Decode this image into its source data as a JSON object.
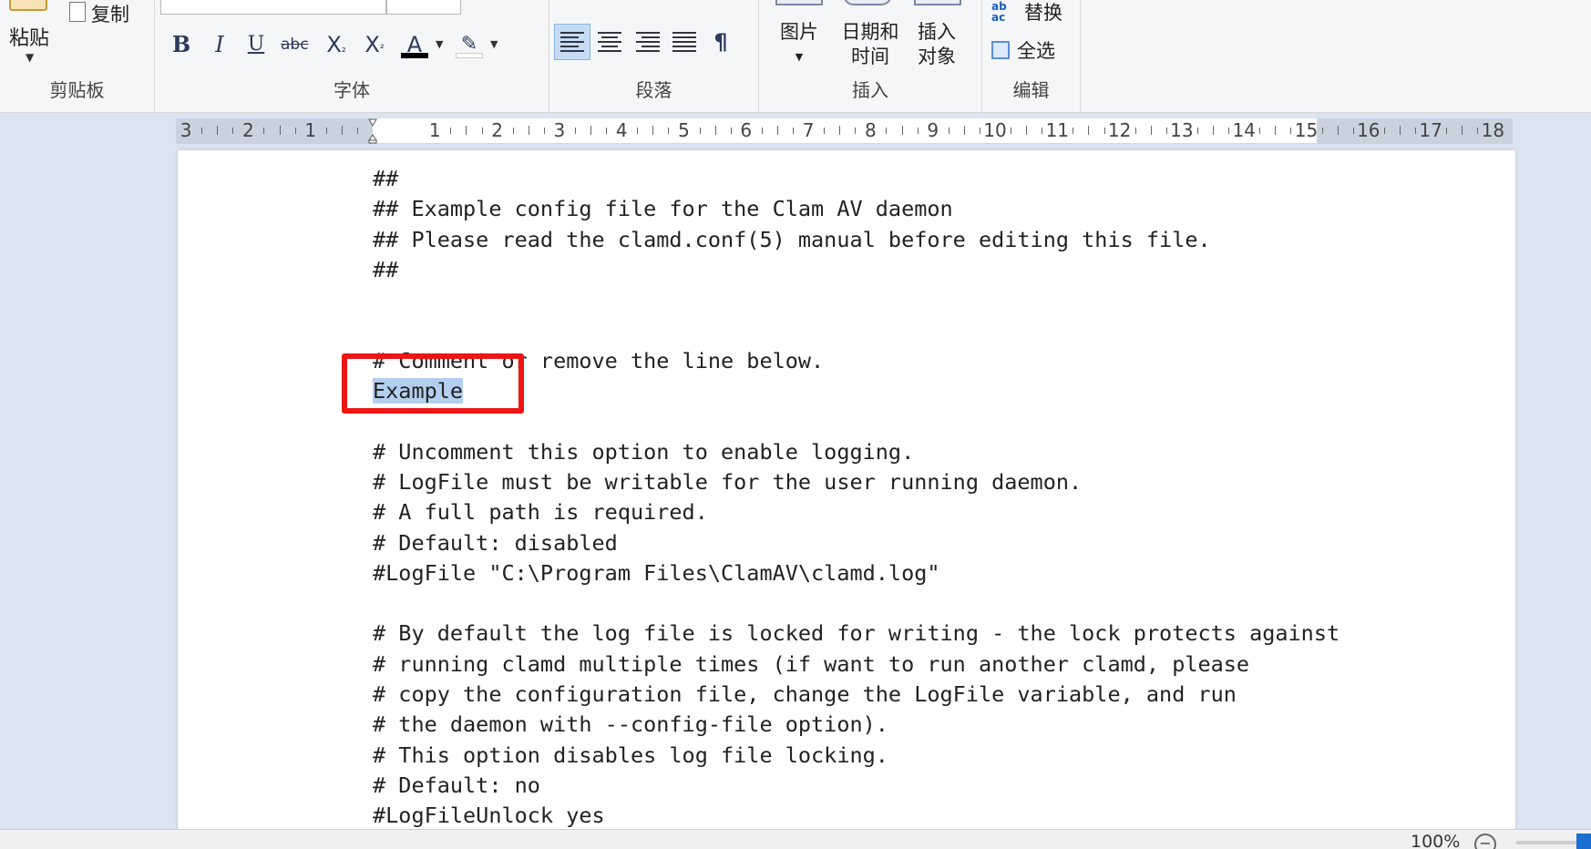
{
  "ribbon": {
    "clipboard": {
      "paste_label": "粘贴",
      "copy_label": "复制",
      "group_label": "剪贴板"
    },
    "font": {
      "group_label": "字体",
      "bold": "B",
      "italic": "I",
      "underline": "U",
      "strike": "abc",
      "subscript": "X",
      "superscript": "X",
      "font_color": "A",
      "highlight": "✎"
    },
    "paragraph": {
      "group_label": "段落",
      "show_marks": "¶"
    },
    "insert": {
      "group_label": "插入",
      "picture_label": "图片",
      "datetime_label_1": "日期和",
      "datetime_label_2": "时间",
      "object_label_1": "插入",
      "object_label_2": "对象"
    },
    "edit": {
      "group_label": "编辑",
      "replace_label": "替换",
      "select_all_label": "全选"
    }
  },
  "ruler": {
    "numbers": [
      "3",
      "2",
      "1",
      "1",
      "2",
      "3",
      "4",
      "5",
      "6",
      "7",
      "8",
      "9",
      "10",
      "11",
      "12",
      "13",
      "14",
      "15",
      "16",
      "17",
      "18"
    ]
  },
  "document": {
    "lines": [
      "##",
      "## Example config file for the Clam AV daemon",
      "## Please read the clamd.conf(5) manual before editing this file.",
      "##",
      "",
      "",
      "# Comment or remove the line below.",
      "Example",
      "",
      "# Uncomment this option to enable logging.",
      "# LogFile must be writable for the user running daemon.",
      "# A full path is required.",
      "# Default: disabled",
      "#LogFile \"C:\\Program Files\\ClamAV\\clamd.log\"",
      "",
      "# By default the log file is locked for writing - the lock protects against",
      "# running clamd multiple times (if want to run another clamd, please",
      "# copy the configuration file, change the LogFile variable, and run",
      "# the daemon with --config-file option).",
      "# This option disables log file locking.",
      "# Default: no",
      "#LogFileUnlock yes"
    ],
    "selected_line_index": 7
  },
  "statusbar": {
    "zoom": "100%"
  },
  "colors": {
    "annotation": "#ee1515",
    "selection": "#b3cff0"
  }
}
